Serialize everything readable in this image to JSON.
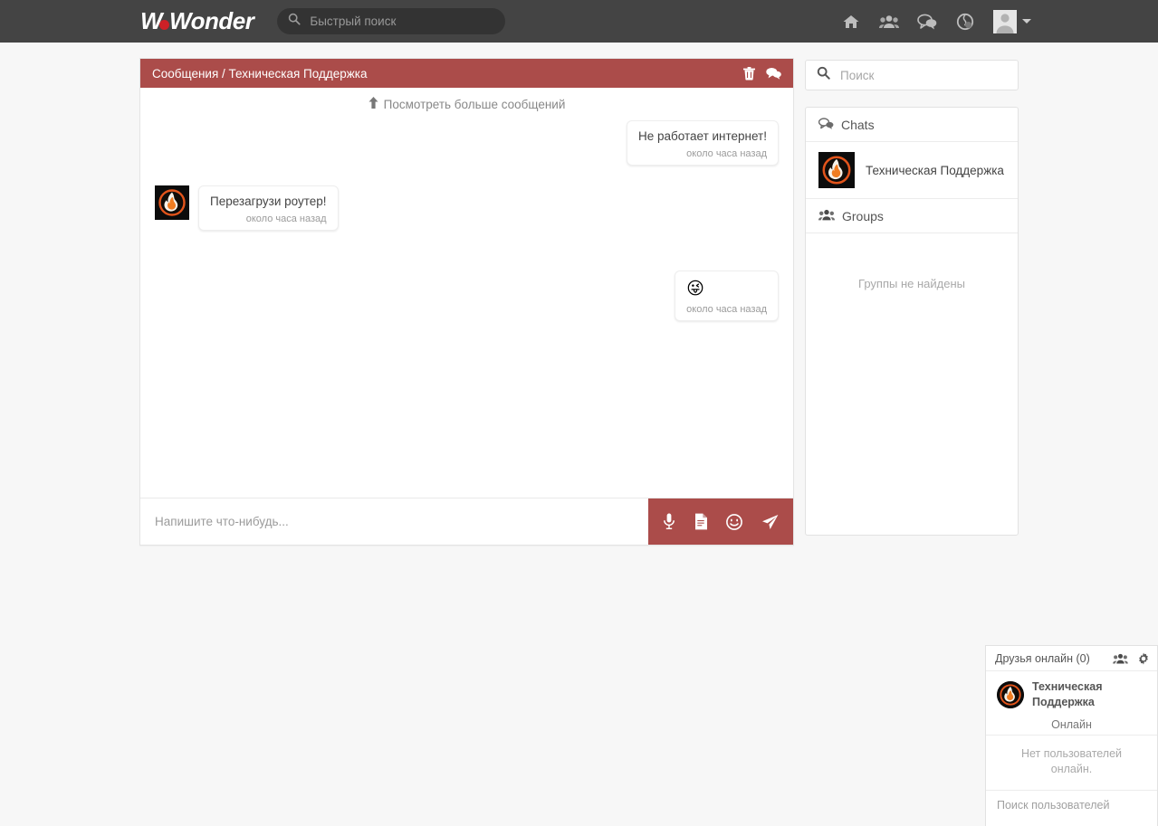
{
  "navbar": {
    "logo_text_1": "W",
    "logo_text_2": "onder",
    "logo_dot_icon": "red-dot",
    "search": {
      "placeholder": "Быстрый поиск",
      "value": "",
      "icon": "search-icon"
    },
    "icons": [
      {
        "name": "home-icon",
        "label": "Home"
      },
      {
        "name": "friends-icon",
        "label": "Friends"
      },
      {
        "name": "messages-icon",
        "label": "Messages"
      },
      {
        "name": "notifications-icon",
        "label": "Notifications"
      }
    ],
    "avatar_icon": "user-avatar",
    "caret_icon": "chevron-down-icon"
  },
  "chat": {
    "header_title": "Сообщения / Техническая Поддержка",
    "header_icons": [
      {
        "name": "delete-icon",
        "label": "Удалить"
      },
      {
        "name": "chat-icon",
        "label": "Чат"
      }
    ],
    "load_more": "Посмотреть больше сообщений",
    "load_more_icon": "arrow-up-icon",
    "messages": [
      {
        "side": "right",
        "text": "Не работает интернет!",
        "time": "около часа назад",
        "is_emoji": false
      },
      {
        "side": "left",
        "text": "Перезагрузи роутер!",
        "time": "около часа назад",
        "is_emoji": false,
        "avatar_icon": "flame-avatar"
      },
      {
        "side": "right",
        "text": "😜",
        "time": "около часа назад",
        "is_emoji": true
      }
    ],
    "composer": {
      "placeholder": "Напишите что-нибудь...",
      "value": "",
      "actions": [
        {
          "name": "microphone-icon",
          "label": "Голосовое сообщение"
        },
        {
          "name": "file-icon",
          "label": "Файл"
        },
        {
          "name": "emoji-icon",
          "label": "Эмодзи"
        },
        {
          "name": "send-icon",
          "label": "Отправить"
        }
      ]
    }
  },
  "sidebar": {
    "search": {
      "placeholder": "Поиск",
      "value": "",
      "icon": "search-icon"
    },
    "chats_section": {
      "title": "Chats",
      "icon": "chat-bubble-icon",
      "items": [
        {
          "name": "Техническая Поддержка",
          "avatar_icon": "flame-avatar"
        }
      ]
    },
    "groups_section": {
      "title": "Groups",
      "icon": "group-icon",
      "empty_text": "Группы не найдены"
    }
  },
  "friends_widget": {
    "title": "Друзья онлайн (0)",
    "header_icons": [
      {
        "name": "group-icon",
        "label": "Группы"
      },
      {
        "name": "gear-icon",
        "label": "Настройки"
      }
    ],
    "user": {
      "name_line1": "Техническая",
      "name_line2": "Поддержка",
      "avatar_icon": "flame-avatar"
    },
    "online_divider": "Онлайн",
    "empty_text": "Нет пользователей онлайн.",
    "search": {
      "placeholder": "Поиск пользователей",
      "value": ""
    }
  },
  "colors": {
    "navbar_bg": "#444444",
    "accent_red": "#ab4c4a",
    "logo_dot": "#cc2127",
    "page_bg": "#f7f7f7",
    "panel_bg": "#ffffff"
  }
}
